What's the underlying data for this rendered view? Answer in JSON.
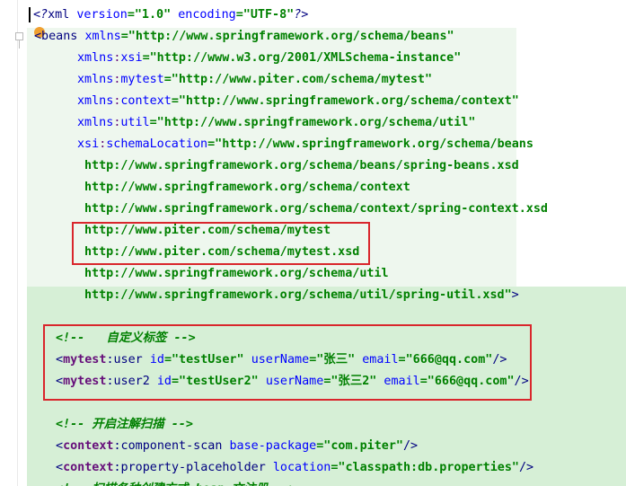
{
  "editor": {
    "lines": [
      {
        "segments": [
          [
            "t-prolog",
            "<?"
          ],
          [
            "t-tag",
            "xml "
          ],
          [
            "t-attr",
            "version"
          ],
          [
            "t-val",
            "=\"1.0\" "
          ],
          [
            "t-attr",
            "encoding"
          ],
          [
            "t-val",
            "=\"UTF-8\""
          ],
          [
            "t-prolog",
            "?>"
          ]
        ]
      },
      {
        "segments": [
          [
            "t-tag",
            "<beans "
          ],
          [
            "t-attr",
            "xmlns"
          ],
          [
            "t-val",
            "=\"http://www.springframework.org/schema/beans\""
          ]
        ]
      },
      {
        "segments": [
          [
            "t-attr",
            "xmlns"
          ],
          [
            "t-nsa",
            ":"
          ],
          [
            "t-attr",
            "xsi"
          ],
          [
            "t-val",
            "=\"http://www.w3.org/2001/XMLSchema-instance\""
          ]
        ]
      },
      {
        "segments": [
          [
            "t-attr",
            "xmlns"
          ],
          [
            "t-nsa",
            ":"
          ],
          [
            "t-attr",
            "mytest"
          ],
          [
            "t-val",
            "=\"http://www.piter.com/schema/mytest\""
          ]
        ]
      },
      {
        "segments": [
          [
            "t-attr",
            "xmlns"
          ],
          [
            "t-nsa",
            ":"
          ],
          [
            "t-attr",
            "context"
          ],
          [
            "t-val",
            "=\"http://www.springframework.org/schema/context\""
          ]
        ]
      },
      {
        "segments": [
          [
            "t-attr",
            "xmlns"
          ],
          [
            "t-nsa",
            ":"
          ],
          [
            "t-attr",
            "util"
          ],
          [
            "t-val",
            "=\"http://www.springframework.org/schema/util\""
          ]
        ]
      },
      {
        "segments": [
          [
            "t-attr",
            "xsi"
          ],
          [
            "t-nsa",
            ":"
          ],
          [
            "t-attr",
            "schemaLocation"
          ],
          [
            "t-val",
            "=\"http://www.springframework.org/schema/beans"
          ]
        ]
      },
      {
        "segments": [
          [
            "t-val",
            "http://www.springframework.org/schema/beans/spring-beans.xsd"
          ]
        ]
      },
      {
        "segments": [
          [
            "t-val",
            "http://www.springframework.org/schema/context"
          ]
        ]
      },
      {
        "segments": [
          [
            "t-val",
            "http://www.springframework.org/schema/context/spring-context.xsd"
          ]
        ]
      },
      {
        "segments": [
          [
            "t-val",
            "http://www.piter.com/schema/mytest"
          ]
        ]
      },
      {
        "segments": [
          [
            "t-val",
            "http://www.piter.com/schema/mytest.xsd"
          ]
        ]
      },
      {
        "segments": [
          [
            "t-val",
            "http://www.springframework.org/schema/util"
          ]
        ]
      },
      {
        "segments": [
          [
            "t-val",
            "http://www.springframework.org/schema/util/spring-util.xsd\""
          ],
          [
            "t-tag",
            ">"
          ]
        ]
      },
      {
        "segments": []
      },
      {
        "segments": [
          [
            "t-cmt-green",
            "<!--   自定义标签 -->"
          ]
        ]
      },
      {
        "segments": [
          [
            "t-tag",
            "<"
          ],
          [
            "t-ns",
            "mytest"
          ],
          [
            "t-tag",
            ":user "
          ],
          [
            "t-attr",
            "id"
          ],
          [
            "t-val",
            "=\"testUser\" "
          ],
          [
            "t-attr",
            "userName"
          ],
          [
            "t-val",
            "=\"张三\" "
          ],
          [
            "t-attr",
            "email"
          ],
          [
            "t-val",
            "=\"666@qq.com\""
          ],
          [
            "t-tag",
            "/>"
          ]
        ]
      },
      {
        "segments": [
          [
            "t-tag",
            "<"
          ],
          [
            "t-ns",
            "mytest"
          ],
          [
            "t-tag",
            ":user2 "
          ],
          [
            "t-attr",
            "id"
          ],
          [
            "t-val",
            "=\"testUser2\" "
          ],
          [
            "t-attr",
            "userName"
          ],
          [
            "t-val",
            "=\"张三2\" "
          ],
          [
            "t-attr",
            "email"
          ],
          [
            "t-val",
            "=\"666@qq.com\""
          ],
          [
            "t-tag",
            "/>"
          ]
        ]
      },
      {
        "segments": []
      },
      {
        "segments": [
          [
            "t-cmt-green",
            "<!-- 开启注解扫描 -->"
          ]
        ]
      },
      {
        "segments": [
          [
            "t-tag",
            "<"
          ],
          [
            "t-ns",
            "context"
          ],
          [
            "t-tag",
            ":component-scan "
          ],
          [
            "t-attr",
            "base-package"
          ],
          [
            "t-val",
            "=\"com.piter\""
          ],
          [
            "t-tag",
            "/>"
          ]
        ]
      },
      {
        "segments": [
          [
            "t-tag",
            "<"
          ],
          [
            "t-ns",
            "context"
          ],
          [
            "t-tag",
            ":property-placeholder "
          ],
          [
            "t-attr",
            "location"
          ],
          [
            "t-val",
            "=\"classpath:db.properties\""
          ],
          [
            "t-tag",
            "/>"
          ]
        ]
      },
      {
        "segments": [
          [
            "t-cmt-green",
            "<!-- 扫描各种创建方式 bean 文注册 -->"
          ]
        ]
      }
    ]
  }
}
